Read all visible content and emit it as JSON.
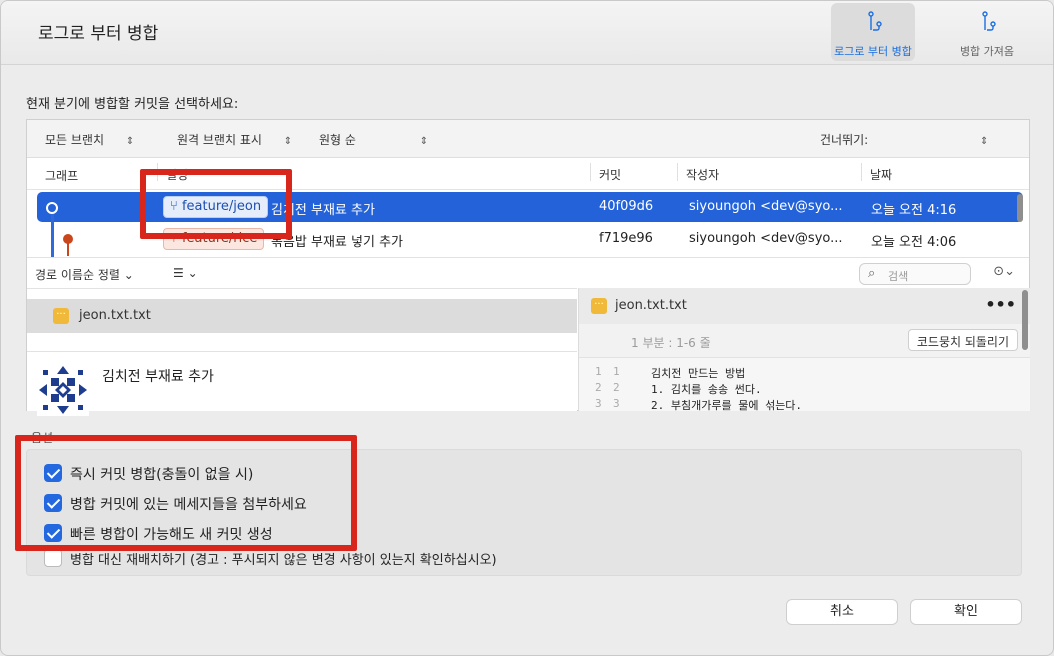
{
  "window": {
    "title": "로그로 부터 병합",
    "segments": [
      {
        "label": "로그로 부터 병합",
        "icon": "merge-log-icon",
        "active": true
      },
      {
        "label": "병합 가져옴",
        "icon": "merge-fetch-icon",
        "active": false
      }
    ]
  },
  "instruction": "현재 분기에 병합할 커밋을 선택하세요:",
  "filters": {
    "all_branches": "모든 브랜치",
    "show_remote": "원격 브랜치 표시",
    "order": "원형 순",
    "skip": "건너뛰기:"
  },
  "columns": {
    "graph": "그래프",
    "description": "설명",
    "commit": "커밋",
    "author": "작성자",
    "date": "날짜"
  },
  "commits": [
    {
      "branch": "feature/jeon",
      "message": "김치전 부재료 추가",
      "hash": "40f09d6",
      "author": "siyoungoh <dev@syo...",
      "date": "오늘 오전 4:16",
      "selected": true
    },
    {
      "branch": "feature/rice",
      "message": "볶음밥 부재료 넣기 추가",
      "hash": "f719e96",
      "author": "siyoungoh <dev@syo...",
      "date": "오늘 오전 4:06",
      "selected": false
    }
  ],
  "sortbar": {
    "sort_label": "경로 이름순 정렬",
    "search_placeholder": "검색"
  },
  "files": [
    {
      "name": "jeon.txt.txt"
    }
  ],
  "commit_detail": {
    "message": "김치전 부재료 추가"
  },
  "diff": {
    "filename": "jeon.txt.txt",
    "hunk_label": "1 부분 : 1-6 줄",
    "revert_label": "코드뭉치 되돌리기",
    "lines": [
      {
        "old": "1",
        "new": "1",
        "text": "김치전 만드는 방법"
      },
      {
        "old": "2",
        "new": "2",
        "text": "1. 김치를 송송 썬다."
      },
      {
        "old": "3",
        "new": "3",
        "text": "2. 부침개가루를 물에 섞는다."
      }
    ]
  },
  "options": {
    "label": "옵션",
    "items": [
      {
        "label": "즉시 커밋 병합(충돌이 없을 시)",
        "checked": true
      },
      {
        "label": "병합 커밋에 있는 메세지들을 첨부하세요",
        "checked": true
      },
      {
        "label": "빠른 병합이 가능해도 새 커밋 생성",
        "checked": true
      },
      {
        "label": "병합 대신 재배치하기 (경고 : 푸시되지 않은 변경 사항이 있는지 확인하십시오)",
        "checked": false
      }
    ]
  },
  "buttons": {
    "cancel": "취소",
    "ok": "확인"
  },
  "colors": {
    "accent": "#2362d9",
    "highlight": "#d9261c",
    "file_icon": "#f0b93a"
  }
}
